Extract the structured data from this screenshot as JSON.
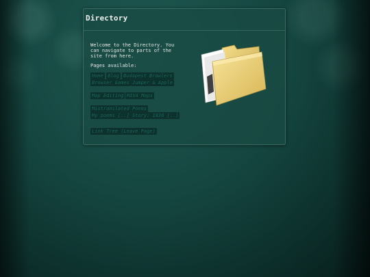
{
  "panel": {
    "title": "Directory",
    "intro": "Welcome to the Directory. You can navigate to parts of the site from here.",
    "pages_label": "Pages available:"
  },
  "links": {
    "home": "Home",
    "blog": "Blog",
    "budapest_brawlers": "Budapest Brawlers",
    "browser_games": "Browser Games",
    "jumper_apple": "Jumper & Apple",
    "map_editing": "Map Editing",
    "miva_maps": "MIVA Maps",
    "mistranslated_poems": "Mistranslated Poems",
    "my_poems": "My poems [:.]",
    "story": "Story: 1830 [:.]",
    "link_tree": "Link Tree (Leave Page)"
  },
  "icons": {
    "folder": "open-folder-icon"
  }
}
